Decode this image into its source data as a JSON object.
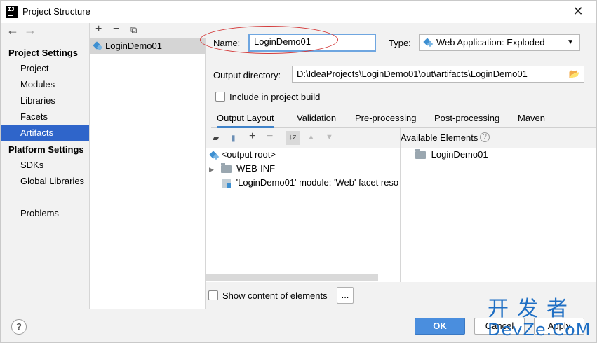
{
  "window": {
    "title": "Project Structure"
  },
  "nav": {
    "project_settings_head": "Project Settings",
    "project_settings": [
      "Project",
      "Modules",
      "Libraries",
      "Facets",
      "Artifacts"
    ],
    "platform_settings_head": "Platform Settings",
    "platform_settings": [
      "SDKs",
      "Global Libraries"
    ],
    "problems": "Problems",
    "selected": "Artifacts"
  },
  "artifacts_list": {
    "items": [
      "LoginDemo01"
    ]
  },
  "form": {
    "name_label": "Name:",
    "name_value": "LoginDemo01",
    "type_label": "Type:",
    "type_value": "Web Application: Exploded",
    "output_dir_label": "Output directory:",
    "output_dir_value": "D:\\IdeaProjects\\LoginDemo01\\out\\artifacts\\LoginDemo01",
    "include_build_label": "Include in project build",
    "include_build_checked": false
  },
  "tabs": [
    "Output Layout",
    "Validation",
    "Pre-processing",
    "Post-processing",
    "Maven"
  ],
  "active_tab": "Output Layout",
  "output_tree": {
    "root": "<output root>",
    "web_inf": "WEB-INF",
    "facet": "'LoginDemo01' module: 'Web' facet reso"
  },
  "available": {
    "header": "Available Elements",
    "items": [
      "LoginDemo01"
    ]
  },
  "show_content_label": "Show content of elements",
  "ellipsis_button": "...",
  "buttons": {
    "ok": "OK",
    "cancel": "Cancel",
    "apply": "Apply"
  },
  "help_label": "?",
  "watermark": {
    "cn": "开发者",
    "en": "DevZe.CoM"
  },
  "colors": {
    "selection": "#2f65ca",
    "primary_button": "#4a8ede",
    "annotation": "#d43c3c",
    "watermark": "#1f6fc4"
  }
}
